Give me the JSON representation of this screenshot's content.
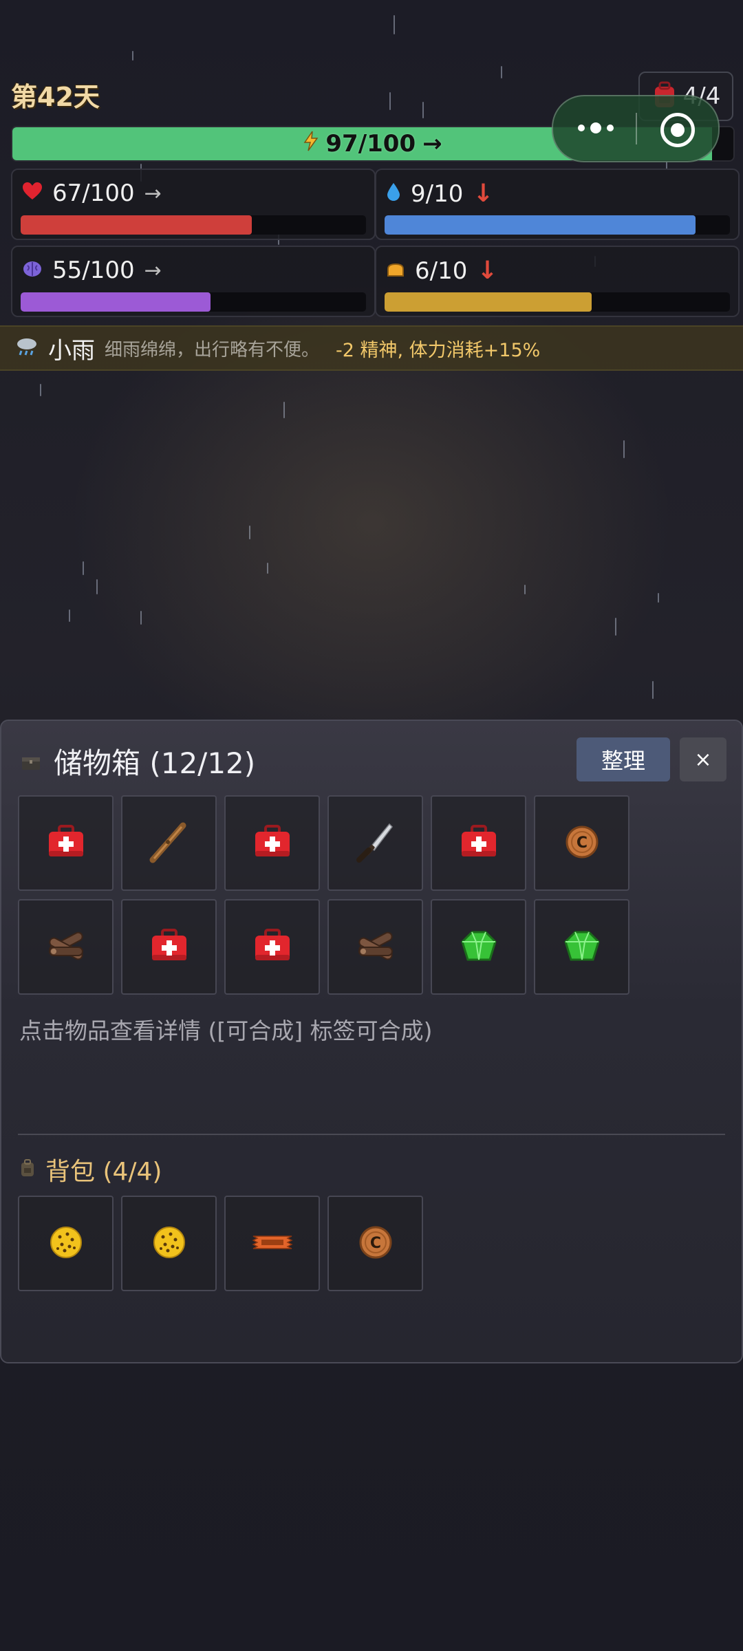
{
  "header": {
    "day": "第42天",
    "bag_count": "4/4"
  },
  "stamina": {
    "text": "97/100",
    "trend": "→",
    "value": 97,
    "max": 100,
    "color": "#52c47a"
  },
  "stats": {
    "health": {
      "text": "67/100",
      "trend": "→",
      "value": 67,
      "max": 100,
      "color": "#cf3f3b"
    },
    "water": {
      "text": "9/10",
      "trend": "↓",
      "value": 9,
      "max": 10,
      "color": "#4f86d8"
    },
    "mind": {
      "text": "55/100",
      "trend": "→",
      "value": 55,
      "max": 100,
      "color": "#9c5ad6"
    },
    "food": {
      "text": "6/10",
      "trend": "↓",
      "value": 6,
      "max": 10,
      "color": "#cc9f33"
    }
  },
  "weather": {
    "name": "小雨",
    "desc": "细雨绵绵，出行略有不便。",
    "effect": "-2 精神, 体力消耗+15%"
  },
  "storage": {
    "title": "储物箱 (12/12)",
    "sort_label": "整理",
    "close_label": "×",
    "items": [
      "medkit-icon",
      "wooden-club-icon",
      "medkit-icon",
      "knife-icon",
      "medkit-icon",
      "coin-icon",
      "wood-logs-icon",
      "medkit-icon",
      "medkit-icon",
      "wood-logs-icon",
      "green-crystal-icon",
      "green-crystal-icon"
    ],
    "hint": "点击物品查看详情 ([可合成] 标签可合成)"
  },
  "backpack": {
    "title": "背包 (4/4)",
    "items": [
      "cookie-icon",
      "cookie-icon",
      "snack-bar-icon",
      "coin-icon"
    ]
  }
}
